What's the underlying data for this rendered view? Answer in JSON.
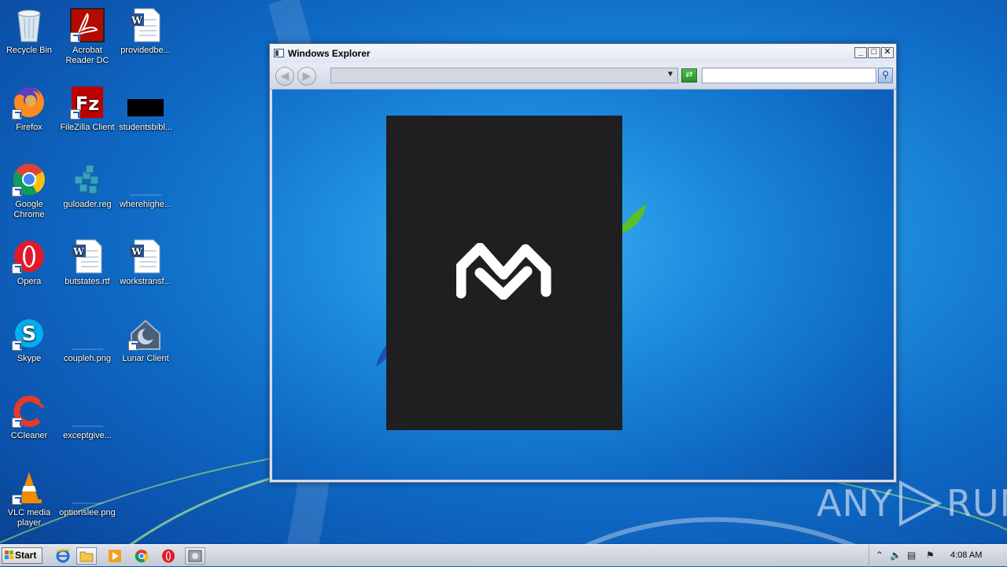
{
  "desktop": {
    "icons": [
      {
        "label": "Recycle Bin"
      },
      {
        "label": "Acrobat Reader DC"
      },
      {
        "label": "providedbe..."
      },
      {
        "label": "Firefox"
      },
      {
        "label": "FileZilla Client"
      },
      {
        "label": "studentsbibl..."
      },
      {
        "label": "Google Chrome"
      },
      {
        "label": "guloader.reg"
      },
      {
        "label": "wherehighe..."
      },
      {
        "label": "Opera"
      },
      {
        "label": "butstates.rtf"
      },
      {
        "label": "workstransf..."
      },
      {
        "label": "Skype"
      },
      {
        "label": "coupleh.png"
      },
      {
        "label": "Lunar Client"
      },
      {
        "label": "CCleaner"
      },
      {
        "label": "exceptgive..."
      },
      {
        "label": "VLC media player"
      },
      {
        "label": "optionslee.png"
      }
    ]
  },
  "window": {
    "title": "Windows Explorer",
    "address_value": "",
    "search_value": "",
    "minimize_glyph": "_",
    "maximize_glyph": "□",
    "close_glyph": "✕"
  },
  "watermark": {
    "left": "ANY",
    "right": "RUN"
  },
  "taskbar": {
    "start_label": "Start",
    "clock": "4:08 AM",
    "pinned": [
      "internet-explorer-icon",
      "windows-explorer-icon",
      "media-player-icon",
      "chrome-icon",
      "opera-icon",
      "app-icon"
    ]
  },
  "colors": {
    "accent": "#0f6cc7",
    "panel": "#1f1e20"
  }
}
